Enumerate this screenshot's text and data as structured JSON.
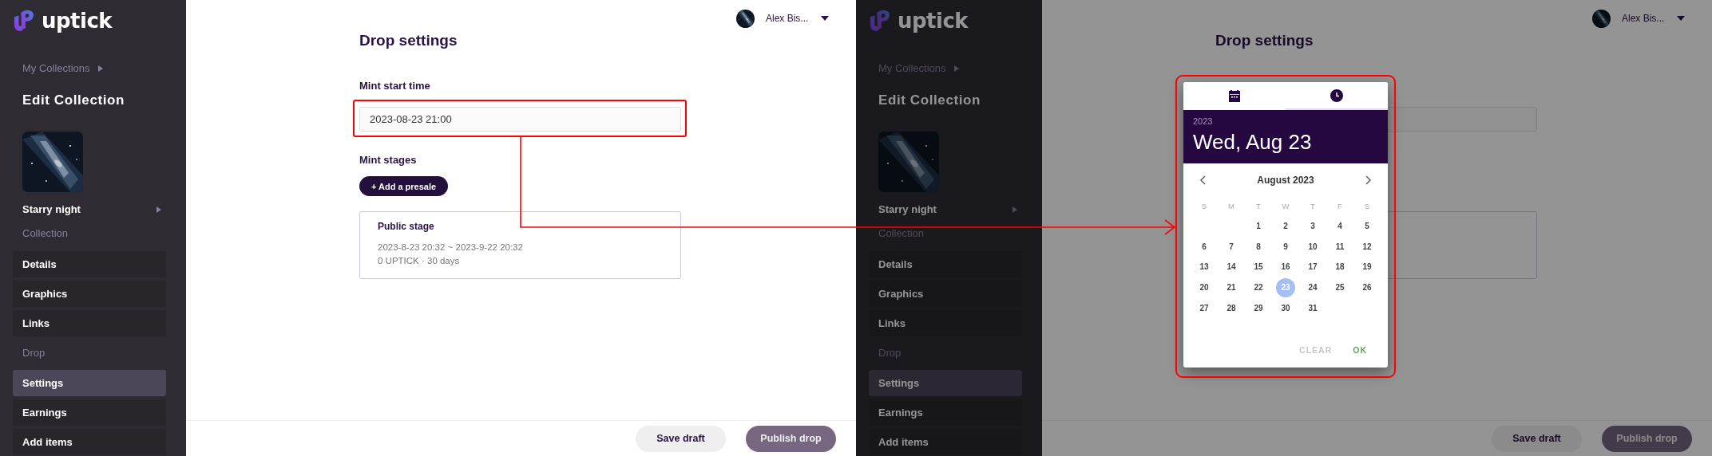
{
  "screens": [
    {
      "dimmed": false,
      "sidebar": {
        "logo": "uptick",
        "breadcrumb": "My Collections",
        "heading": "Edit Collection",
        "collection": {
          "name": "Starry night",
          "type": "Collection"
        },
        "nav": [
          {
            "kind": "link",
            "label": "Details",
            "selected": false
          },
          {
            "kind": "link",
            "label": "Graphics",
            "selected": false
          },
          {
            "kind": "link",
            "label": "Links",
            "selected": false
          },
          {
            "kind": "heading",
            "label": "Drop"
          },
          {
            "kind": "link",
            "label": "Settings",
            "selected": true
          },
          {
            "kind": "link",
            "label": "Earnings",
            "selected": false
          },
          {
            "kind": "link",
            "label": "Add items",
            "selected": false
          }
        ]
      },
      "user": {
        "name": "Alex Bis..."
      },
      "page": {
        "title": "Drop settings",
        "start_label": "Mint start time",
        "start_value": "2023-08-23 21:00",
        "stages_label": "Mint stages",
        "add_button": "+ Add a presale",
        "stage": {
          "title": "Public stage",
          "dates": "2023-8-23 20:32 ~ 2023-9-22 20:32",
          "details": "0 UPTICK · 30 days"
        }
      },
      "footer": {
        "save": "Save draft",
        "publish": "Publish drop"
      }
    },
    {
      "dimmed": true,
      "sidebar": {
        "logo": "uptick",
        "breadcrumb": "My Collections",
        "heading": "Edit Collection",
        "collection": {
          "name": "Starry night",
          "type": "Collection"
        },
        "nav": [
          {
            "kind": "link",
            "label": "Details",
            "selected": false
          },
          {
            "kind": "link",
            "label": "Graphics",
            "selected": false
          },
          {
            "kind": "link",
            "label": "Links",
            "selected": false
          },
          {
            "kind": "heading",
            "label": "Drop"
          },
          {
            "kind": "link",
            "label": "Settings",
            "selected": true
          },
          {
            "kind": "link",
            "label": "Earnings",
            "selected": false
          },
          {
            "kind": "link",
            "label": "Add items",
            "selected": false
          }
        ]
      },
      "user": {
        "name": "Alex Bis..."
      },
      "page": {
        "title": "Drop settings"
      },
      "footer": {
        "save": "Save draft",
        "publish": "Publish drop"
      },
      "date_picker": {
        "tabs": [
          {
            "kind": "date",
            "selected": true
          },
          {
            "kind": "time",
            "selected": false
          }
        ],
        "year": "2023",
        "date": "Wed, Aug 23",
        "month": "August 2023",
        "weekdays": [
          "S",
          "M",
          "T",
          "W",
          "T",
          "F",
          "S"
        ],
        "weeks": [
          [
            {
              "kind": "blank"
            },
            {
              "kind": "blank"
            },
            {
              "kind": "day",
              "label": "1",
              "selected": false
            },
            {
              "kind": "day",
              "label": "2",
              "selected": false
            },
            {
              "kind": "day",
              "label": "3",
              "selected": false
            },
            {
              "kind": "day",
              "label": "4",
              "selected": false
            },
            {
              "kind": "day",
              "label": "5",
              "selected": false
            }
          ],
          [
            {
              "kind": "day",
              "label": "6",
              "selected": false
            },
            {
              "kind": "day",
              "label": "7",
              "selected": false
            },
            {
              "kind": "day",
              "label": "8",
              "selected": false
            },
            {
              "kind": "day",
              "label": "9",
              "selected": false
            },
            {
              "kind": "day",
              "label": "10",
              "selected": false
            },
            {
              "kind": "day",
              "label": "11",
              "selected": false
            },
            {
              "kind": "day",
              "label": "12",
              "selected": false
            }
          ],
          [
            {
              "kind": "day",
              "label": "13",
              "selected": false
            },
            {
              "kind": "day",
              "label": "14",
              "selected": false
            },
            {
              "kind": "day",
              "label": "15",
              "selected": false
            },
            {
              "kind": "day",
              "label": "16",
              "selected": false
            },
            {
              "kind": "day",
              "label": "17",
              "selected": false
            },
            {
              "kind": "day",
              "label": "18",
              "selected": false
            },
            {
              "kind": "day",
              "label": "19",
              "selected": false
            }
          ],
          [
            {
              "kind": "day",
              "label": "20",
              "selected": false
            },
            {
              "kind": "day",
              "label": "21",
              "selected": false
            },
            {
              "kind": "day",
              "label": "22",
              "selected": false
            },
            {
              "kind": "day",
              "label": "23",
              "selected": true
            },
            {
              "kind": "day",
              "label": "24",
              "selected": false
            },
            {
              "kind": "day",
              "label": "25",
              "selected": false
            },
            {
              "kind": "day",
              "label": "26",
              "selected": false
            }
          ],
          [
            {
              "kind": "day",
              "label": "27",
              "selected": false
            },
            {
              "kind": "day",
              "label": "28",
              "selected": false
            },
            {
              "kind": "day",
              "label": "29",
              "selected": false
            },
            {
              "kind": "day",
              "label": "30",
              "selected": false
            },
            {
              "kind": "day",
              "label": "31",
              "selected": false
            }
          ]
        ],
        "actions": [
          {
            "label": "CLEAR",
            "disabled": true
          },
          {
            "label": "OK",
            "disabled": false
          }
        ]
      }
    }
  ]
}
